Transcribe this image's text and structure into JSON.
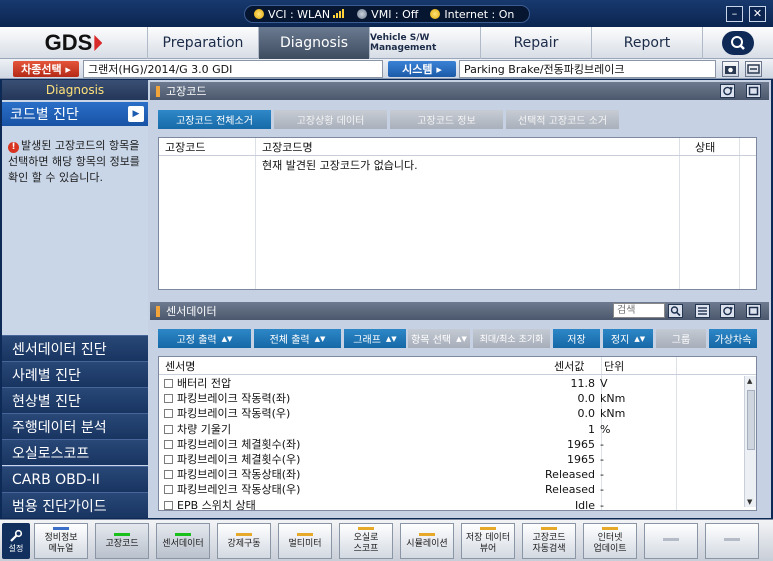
{
  "status": {
    "vci": "VCI : WLAN",
    "vmi": "VMI : Off",
    "internet": "Internet : On"
  },
  "window": {
    "minimize": "–",
    "close": "✕"
  },
  "nav": {
    "logo": "GDS",
    "tabs": [
      "Preparation",
      "Diagnosis",
      "Vehicle S/W Management",
      "Repair",
      "Report"
    ]
  },
  "context": {
    "vehicle_label": "차종선택 ▸",
    "vehicle_value": "그랜저(HG)/2014/G 3.0 GDI",
    "system_label": "시스템 ▸",
    "system_value": "Parking Brake/전동파킹브레이크"
  },
  "sidebar": {
    "header": "Diagnosis",
    "active": "코드별 진단",
    "message": "발생된 고장코드의 항목을 선택하면 해당 항목의 정보를 확인 할 수 있습니다.",
    "items": [
      "센서데이터 진단",
      "사례별 진단",
      "현상별 진단",
      "주행데이터 분석",
      "오실로스코프",
      "CARB OBD-II",
      "범용 진단가이드"
    ]
  },
  "dtc": {
    "title": "고장코드",
    "tabs": [
      "고장코드 전체소거",
      "고장상황 데이터",
      "고장코드 정보",
      "선택적 고장코드 소거"
    ],
    "columns": [
      "고장코드",
      "고장코드명",
      "상태"
    ],
    "empty_message": "현재 발견된 고장코드가 없습니다."
  },
  "sensor": {
    "title": "센서데이터",
    "search_placeholder": "검색",
    "buttons": [
      "고정 출력",
      "전체 출력",
      "그래프",
      "항목 선택",
      "최대/최소 초기화",
      "저장",
      "정지",
      "그룹",
      "가상차속"
    ],
    "columns": [
      "센서명",
      "센서값",
      "단위"
    ],
    "rows": [
      {
        "name": "배터리 전압",
        "value": "11.8",
        "unit": "V"
      },
      {
        "name": "파킹브레이크 작동력(좌)",
        "value": "0.0",
        "unit": "kNm"
      },
      {
        "name": "파킹브레이크 작동력(우)",
        "value": "0.0",
        "unit": "kNm"
      },
      {
        "name": "차량 기울기",
        "value": "1",
        "unit": "%"
      },
      {
        "name": "파킹브레이크 체결횟수(좌)",
        "value": "1965",
        "unit": "-"
      },
      {
        "name": "파킹브레이크 체결횟수(우)",
        "value": "1965",
        "unit": "-"
      },
      {
        "name": "파킹브레이크 작동상태(좌)",
        "value": "Released",
        "unit": "-"
      },
      {
        "name": "파킹브레인크 작동상태(우)",
        "value": "Released",
        "unit": "-"
      },
      {
        "name": "EPB 스위치 상태",
        "value": "Idle",
        "unit": "-"
      }
    ]
  },
  "bottom": {
    "settings": "설정",
    "buttons": [
      {
        "l1": "정비정보",
        "l2": "메뉴얼",
        "ind": "#3c6fc8"
      },
      {
        "l1": "고장코드",
        "l2": "",
        "ind": "#19c01b"
      },
      {
        "l1": "센서데이터",
        "l2": "",
        "ind": "#19c01b"
      },
      {
        "l1": "강제구동",
        "l2": "",
        "ind": "#e7a92a"
      },
      {
        "l1": "멀티미터",
        "l2": "",
        "ind": "#e7a92a"
      },
      {
        "l1": "오실로",
        "l2": "스코프",
        "ind": "#e7a92a"
      },
      {
        "l1": "시뮬레이션",
        "l2": "",
        "ind": "#e7a92a"
      },
      {
        "l1": "저장 데이터",
        "l2": "뷰어",
        "ind": "#e7a92a"
      },
      {
        "l1": "고장코드",
        "l2": "자동검색",
        "ind": "#e7a92a"
      },
      {
        "l1": "인터넷",
        "l2": "업데이트",
        "ind": "#e7a92a"
      },
      {
        "l1": "",
        "l2": "",
        "ind": "#b5bcc7"
      },
      {
        "l1": "",
        "l2": "",
        "ind": "#b5bcc7"
      }
    ]
  }
}
